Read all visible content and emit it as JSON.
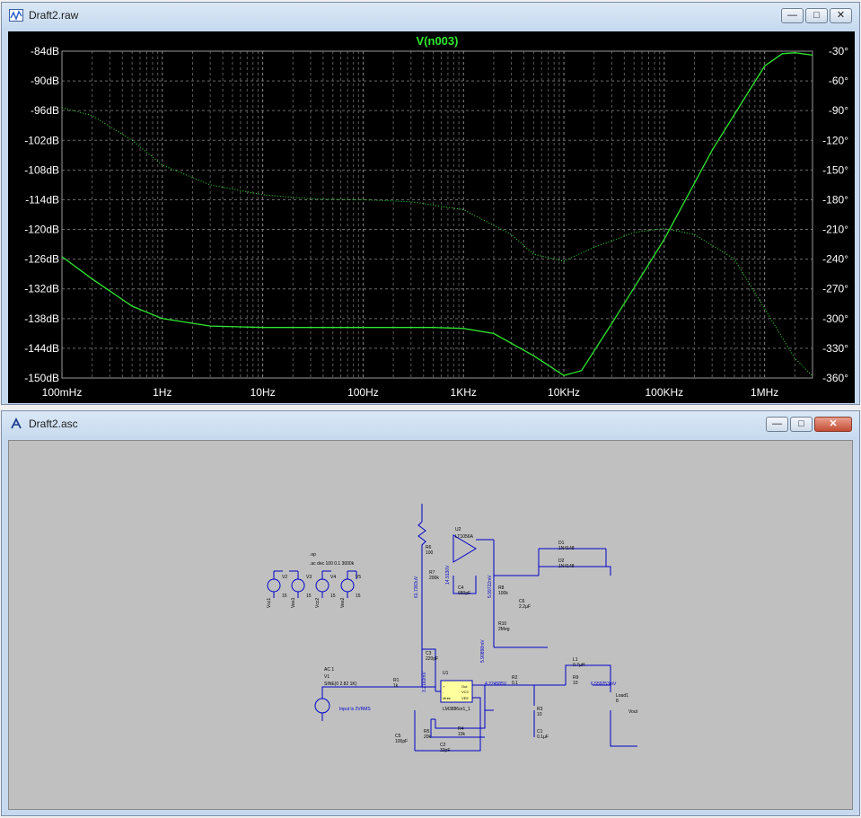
{
  "plot_window": {
    "title": "Draft2.raw",
    "trace_title": "V(n003)",
    "buttons": {
      "minimize": "—",
      "maximize": "□",
      "close": "✕"
    }
  },
  "schematic_window": {
    "title": "Draft2.asc",
    "buttons": {
      "minimize": "—",
      "maximize": "□",
      "close": "✕"
    }
  },
  "chart_data": {
    "type": "line",
    "title": "V(n003)",
    "x_scale": "log",
    "x_ticks": [
      "100mHz",
      "1Hz",
      "10Hz",
      "100Hz",
      "1KHz",
      "10KHz",
      "100KHz",
      "1MHz"
    ],
    "y_left_ticks": [
      "-84dB",
      "-90dB",
      "-96dB",
      "-102dB",
      "-108dB",
      "-114dB",
      "-120dB",
      "-126dB",
      "-132dB",
      "-138dB",
      "-144dB",
      "-150dB"
    ],
    "y_right_ticks": [
      "-30°",
      "-60°",
      "-90°",
      "-120°",
      "-150°",
      "-180°",
      "-210°",
      "-240°",
      "-270°",
      "-300°",
      "-330°",
      "-360°"
    ],
    "ylim_left": [
      -150,
      -84
    ],
    "ylim_right": [
      -360,
      -30
    ],
    "xlim_hz": [
      0.1,
      3000000
    ],
    "grid": true,
    "series": [
      {
        "name": "magnitude (dB)",
        "style": "solid",
        "color": "#2ee82e",
        "x": [
          0.1,
          0.2,
          0.5,
          1,
          3,
          10,
          100,
          500,
          1000,
          2000,
          5000,
          10000,
          15000,
          30000,
          100000,
          300000,
          1000000,
          1500000,
          2000000,
          3000000
        ],
        "y": [
          -125.5,
          -130,
          -135.5,
          -138,
          -139.5,
          -139.8,
          -139.8,
          -139.8,
          -140,
          -141,
          -145.5,
          -149.5,
          -148.5,
          -139,
          -122,
          -104,
          -87,
          -84.5,
          -84.3,
          -84.8
        ]
      },
      {
        "name": "phase (deg)",
        "style": "dotted",
        "color": "#2ee82e",
        "x": [
          0.1,
          0.2,
          0.5,
          1,
          3,
          10,
          30,
          100,
          300,
          1000,
          3000,
          5000,
          10000,
          20000,
          50000,
          100000,
          200000,
          500000,
          1000000,
          2000000,
          3000000
        ],
        "y": [
          -87,
          -95,
          -120,
          -145,
          -165,
          -175,
          -179,
          -180,
          -182,
          -190,
          -215,
          -235,
          -242,
          -228,
          -213,
          -209,
          -215,
          -240,
          -290,
          -340,
          -358
        ]
      }
    ]
  },
  "schematic": {
    "directive_op": ".op",
    "directive_ac": ".ac dec 100 0.1 3000k",
    "sources": [
      {
        "name": "V2",
        "value": "15",
        "net": "Vcc1"
      },
      {
        "name": "V3",
        "value": "15",
        "net": "Vee1"
      },
      {
        "name": "V4",
        "value": "15",
        "net": "Vcc2"
      },
      {
        "name": "V5",
        "value": "15",
        "net": "Vee2"
      }
    ],
    "v1": {
      "ac": "AC 1",
      "name": "V1",
      "wave": "SINE(0 2.82 1K)",
      "note": "Input is 2VRMS"
    },
    "u1": {
      "name": "U1",
      "part": "LM3886or1_1",
      "pins": [
        "+",
        "-",
        "Mute",
        "Out",
        "VCC",
        "VEE"
      ]
    },
    "u2": {
      "name": "U2",
      "part": "LT1056A"
    },
    "parts": [
      {
        "name": "R1",
        "value": "1k"
      },
      {
        "name": "R2",
        "value": "0.1"
      },
      {
        "name": "R3",
        "value": "10"
      },
      {
        "name": "R4",
        "value": "10k"
      },
      {
        "name": "R5",
        "value": "20k"
      },
      {
        "name": "R6",
        "value": "100"
      },
      {
        "name": "R7",
        "value": "200k"
      },
      {
        "name": "R8",
        "value": "100k"
      },
      {
        "name": "R9",
        "value": "10"
      },
      {
        "name": "R10",
        "value": "2Meg"
      },
      {
        "name": "C1",
        "value": "0.1µF"
      },
      {
        "name": "C2",
        "value": "33pF"
      },
      {
        "name": "C3",
        "value": "220pF"
      },
      {
        "name": "C4",
        "value": "680pF"
      },
      {
        "name": "C5",
        "value": "100pF"
      },
      {
        "name": "C6",
        "value": "2.2µF"
      },
      {
        "name": "L1",
        "value": "0.7µH"
      },
      {
        "name": "D1",
        "value": "1N4148"
      },
      {
        "name": "D2",
        "value": "1N4148"
      },
      {
        "name": "Load1",
        "value": "8"
      }
    ],
    "net_vout": "Vout",
    "probes": [
      "61.7363uV",
      "14.9130V",
      "5.99722mV",
      "3.2160mV",
      "4.224585V",
      "6.559253mV",
      "5.90898mV"
    ]
  }
}
